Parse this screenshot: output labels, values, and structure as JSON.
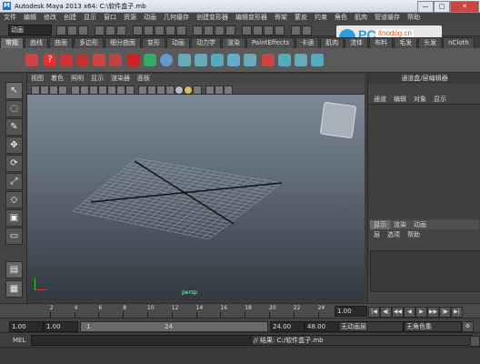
{
  "window": {
    "title": "Autodesk Maya 2013 x64: C:\\软件盒子.mb",
    "minimize": "—",
    "maximize": "□",
    "close": "✕"
  },
  "menubar": [
    "文件",
    "编辑",
    "修改",
    "创建",
    "显示",
    "窗口",
    "资源",
    "动画",
    "几何缓存",
    "创建变形器",
    "编辑变形器",
    "骨架",
    "蒙皮",
    "约束",
    "角色",
    "肌肉",
    "管道缓存",
    "帮助"
  ],
  "statusline": {
    "mode": "动画"
  },
  "shelf_tabs": [
    "常规",
    "曲线",
    "曲面",
    "多边形",
    "细分曲面",
    "变形",
    "动画",
    "动力学",
    "渲染",
    "PaintEffects",
    "卡通",
    "肌肉",
    "流体",
    "布料",
    "毛发",
    "头发",
    "nCloth",
    "自定义"
  ],
  "shelf_active": "常规",
  "panel_menu": [
    "视图",
    "着色",
    "照明",
    "显示",
    "渲染器",
    "面板"
  ],
  "viewport": {
    "axis_label": "persp"
  },
  "right_panel": {
    "title": "通道盒/层编辑器",
    "tabs": [
      "通道",
      "编辑",
      "对象",
      "显示"
    ],
    "layer_tabs": [
      "显示",
      "渲染",
      "动画"
    ],
    "layer_menu": [
      "层",
      "选项",
      "帮助"
    ]
  },
  "time_slider": {
    "ticks": [
      "2",
      "4",
      "6",
      "8",
      "10",
      "12",
      "14",
      "16",
      "18",
      "20",
      "22",
      "24"
    ],
    "current": "1.00"
  },
  "range": {
    "start": "1.00",
    "playback_start": "1.00",
    "slider_start": "1",
    "slider_end": "24",
    "playback_end": "24.00",
    "end": "48.00",
    "anim_layer": "无动画层",
    "char_set": "无角色集"
  },
  "mel": {
    "label": "MEL",
    "result": "// 结果: C:/软件盒子.mb"
  },
  "watermark": {
    "text": "PC6.com",
    "sub": "itnodog.cn"
  },
  "colors": {
    "accent": "#e05a1a",
    "viewport_top": "#7b8895",
    "viewport_bottom": "#323840"
  }
}
